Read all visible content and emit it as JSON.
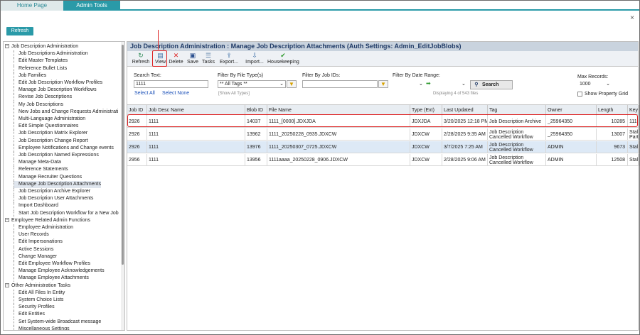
{
  "tabs": [
    {
      "label": "Home Page"
    },
    {
      "label": "Admin Tools"
    }
  ],
  "close_glyph": "×",
  "refresh_top_label": "Refresh",
  "sidebar": {
    "groups": [
      {
        "label": "Job Description Administration",
        "items": [
          "Job Descriptions Administration",
          "Edit Master Templates",
          "Reference Bullet Lists",
          "Job Families",
          "Edit Job Description Workflow Profiles",
          "Manage Job Description Workflows",
          "Revise Job Descriptions",
          "My Job Descriptions",
          "New Jobs and Change Requests Administrati",
          "Multi-Language Administration",
          "Edit Simple Questionnaires",
          "Job Description Matrix Explorer",
          "Job Description Change Report",
          "Employee Notifications and Change events",
          "Job Description Named Expressions",
          "Manage Meta-Data",
          "Reference Statements",
          "Manage Recruiter Questions",
          "Manage Job Description Attachments",
          "Job Description Archive Explorer",
          "Job Description User Attachments",
          "Import Dashboard",
          "Start Job Description Workflow for a New Job"
        ]
      },
      {
        "label": "Employee Related Admin Functions",
        "items": [
          "Employee Administration",
          "User Records",
          "Edit Impersonations",
          "Active Sessions",
          "Change Manager",
          "Edit Employee Workflow Profiles",
          "Manage Employee Acknowledgements",
          "Manage Employee Attachments"
        ]
      },
      {
        "label": "Other Administration Tasks",
        "items": [
          "Edit All Files In Entity",
          "System Choice Lists",
          "Security Profiles",
          "Edit Entities",
          "Set System-wide Broadcast message",
          "Miscellaneous Settings"
        ]
      }
    ],
    "selected": "Manage Job Description Attachments"
  },
  "main": {
    "title": "Job Description Administration : Manage Job Description Attachments (Auth Settings: Admin_EditJobBlobs)",
    "toolbar": [
      {
        "label": "Refresh",
        "icon": "refresh-icon",
        "glyph": "↻",
        "color": "#2e8b57"
      },
      {
        "label": "View",
        "icon": "view-icon",
        "glyph": "▤",
        "color": "#3a6ea5"
      },
      {
        "label": "Delete",
        "icon": "delete-icon",
        "glyph": "✕",
        "color": "#d22"
      },
      {
        "label": "Save",
        "icon": "save-icon",
        "glyph": "▣",
        "color": "#2a4f8f"
      },
      {
        "label": "Tasks",
        "icon": "tasks-icon",
        "glyph": "☰",
        "color": "#5a7fa8"
      },
      {
        "label": "Export...",
        "icon": "export-icon",
        "glyph": "⇪",
        "color": "#3a6ea5"
      },
      {
        "label": "Import...",
        "icon": "import-icon",
        "glyph": "⇩",
        "color": "#3a6ea5"
      },
      {
        "label": "Housekeeping",
        "icon": "housekeeping-icon",
        "glyph": "✔",
        "color": "#2e9a2e"
      }
    ],
    "filters": {
      "search_text_label": "Search Text:",
      "search_text_value": "1111",
      "select_all": "Select All",
      "select_none": "Select None",
      "file_type_label": "Filter By File Type(s)",
      "file_type_value": "** All Tags **",
      "show_all_types": "[Show All Types]",
      "job_ids_label": "Filter By Job IDs:",
      "date_range_label": "Filter By Date Range:",
      "displaying": "Displaying 4 of 543 files",
      "search_button": "Search",
      "max_records_label": "Max Records:",
      "max_records_value": "1000",
      "show_property_grid": "Show Property Grid"
    },
    "columns": [
      "Job ID",
      "Job Desc Name",
      "Blob ID",
      "File Name",
      "Type (Ext)",
      "Last Updated",
      "Tag",
      "Owner",
      "Length",
      "Key"
    ],
    "rows": [
      [
        "2926",
        "1111",
        "14037",
        "1111_[0000].JDXJDA",
        "JDXJDA",
        "3/20/2025 12:18 PM",
        "Job Description Archive",
        "_25964350",
        "10285",
        "111"
      ],
      [
        "2926",
        "1111",
        "13962",
        "1111_20250228_0935.JDXCW",
        "JDXCW",
        "2/28/2025 9:35 AM",
        "Job Description Cancelled Workflow",
        "_25964350",
        "13007",
        "Stal Parti"
      ],
      [
        "2926",
        "1111",
        "13976",
        "1111_20250307_0725.JDXCW",
        "JDXCW",
        "3/7/2025 7:25 AM",
        "Job Description Cancelled Workflow",
        "ADMIN",
        "9673",
        "Stal"
      ],
      [
        "2956",
        "1111",
        "13956",
        "1111aaaa_20250228_0906.JDXCW",
        "JDXCW",
        "2/28/2025 9:06 AM",
        "Job Description Cancelled Workflow",
        "ADMIN",
        "12508",
        "Stal"
      ]
    ]
  }
}
